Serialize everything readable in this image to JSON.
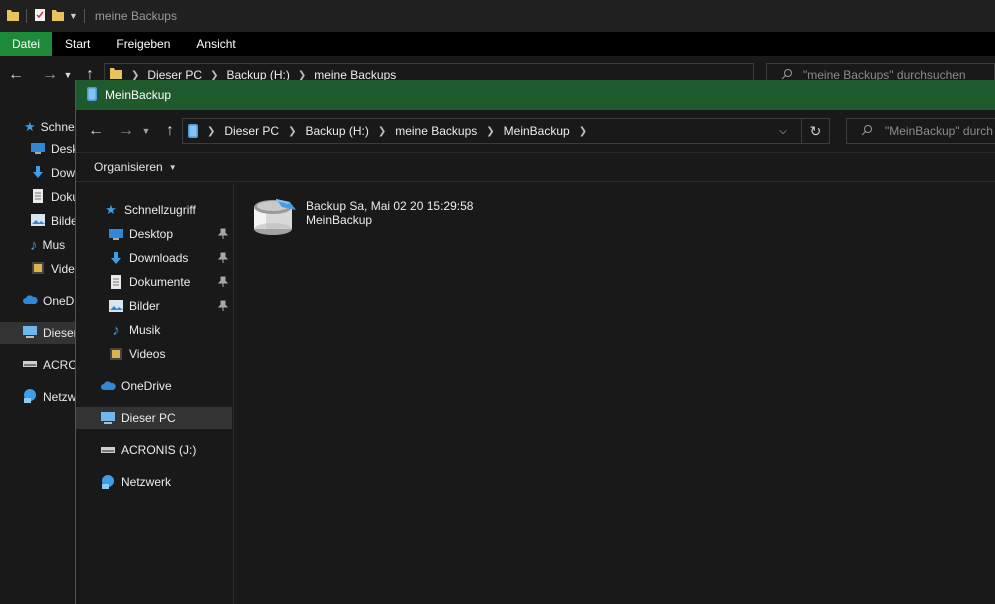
{
  "background_window": {
    "title": "meine Backups",
    "ribbon_tabs": [
      "Datei",
      "Start",
      "Freigeben",
      "Ansicht"
    ],
    "breadcrumb": [
      "Dieser PC",
      "Backup (H:)",
      "meine Backups"
    ],
    "search_placeholder": "\"meine Backups\" durchsuchen",
    "sidebar": [
      "Schne",
      "Desk",
      "Dow",
      "Doku",
      "Bilde",
      "Mus",
      "Vide",
      "OneDr",
      "Dieser",
      "ACRON",
      "Netzw"
    ]
  },
  "front_window": {
    "title": "MeinBackup",
    "breadcrumb": [
      "Dieser PC",
      "Backup (H:)",
      "meine Backups",
      "MeinBackup"
    ],
    "search_placeholder": "\"MeinBackup\" durch",
    "toolbar": {
      "organize_label": "Organisieren"
    },
    "sidebar": {
      "quick_access": "Schnellzugriff",
      "items": [
        {
          "label": "Desktop",
          "icon": "desktop-icon",
          "pinned": true
        },
        {
          "label": "Downloads",
          "icon": "download-icon",
          "pinned": true
        },
        {
          "label": "Dokumente",
          "icon": "document-icon",
          "pinned": true
        },
        {
          "label": "Bilder",
          "icon": "pictures-icon",
          "pinned": true
        },
        {
          "label": "Musik",
          "icon": "music-icon",
          "pinned": false
        },
        {
          "label": "Videos",
          "icon": "video-icon",
          "pinned": false
        }
      ],
      "onedrive": "OneDrive",
      "this_pc": "Dieser PC",
      "acronis": "ACRONIS (J:)",
      "network": "Netzwerk"
    },
    "content": {
      "backup_name": "Backup Sa, Mai 02 20 15:29:58",
      "backup_subtitle": "MeinBackup"
    }
  },
  "colors": {
    "title_bar_active": "#1e5a2c",
    "file_tab": "#1d8a3a",
    "background": "#191919",
    "selected": "#333333"
  }
}
